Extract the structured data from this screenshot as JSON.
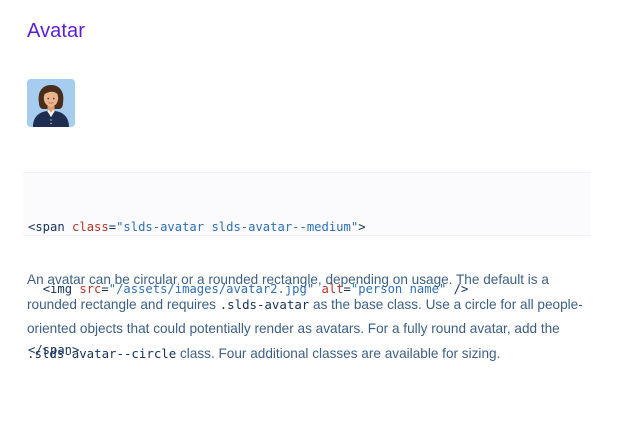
{
  "heading": "Avatar",
  "avatar": {
    "icon": "person-avatar-image",
    "colors": {
      "background": "#a6ccf0",
      "hair": "#4a2c1b",
      "skin": "#e8b48c",
      "suit": "#1f2d50",
      "shirt": "#ffffff"
    }
  },
  "code": {
    "line1": {
      "open": "<span ",
      "attr": "class",
      "eq": "=",
      "value": "\"slds-avatar slds-avatar--medium\"",
      "close": ">"
    },
    "line2": {
      "indent": "  ",
      "open": "<img ",
      "attr1": "src",
      "eq1": "=",
      "value1": "\"/assets/images/avatar2.jpg\"",
      "space": " ",
      "attr2": "alt",
      "eq2": "=",
      "value2": "\"person name\"",
      "close": " />"
    },
    "line3": {
      "tag": "</span>"
    }
  },
  "description": {
    "part1": "An avatar can be circular or a rounded rectangle, depending on usage. The default is a rounded rectangle and requires ",
    "code1": ".slds-avatar",
    "part2": " as the base class. Use a circle for all people-oriented objects that could potentially render as avatars. For a fully round avatar, add the ",
    "code2": ".slds-avatar--circle",
    "part3": " class. Four additional classes are available for sizing."
  },
  "colors": {
    "heading": "#5a1ed6",
    "body_text": "#3c5f88",
    "code_tag": "#16325c",
    "code_attr": "#b8342a",
    "code_string": "#2e6fb8",
    "code_background": "#fbfbfd"
  }
}
